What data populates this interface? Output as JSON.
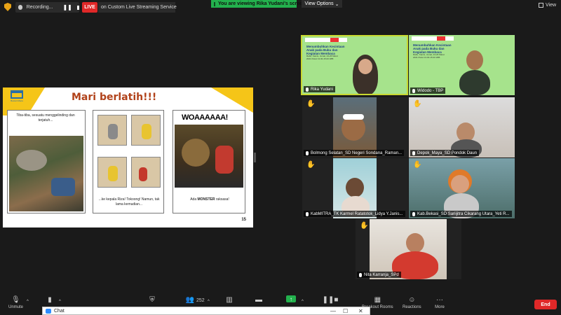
{
  "topbar": {
    "recording_label": "Recording...",
    "pause_icon": "pause-icon",
    "live_label": "LIVE",
    "live_service": "on Custom Live Streaming Service",
    "viewing_banner": "You are viewing Rika Yudani's screen",
    "view_options": "View Options",
    "view_label": "View"
  },
  "slide": {
    "title": "Mari berlatih!!!",
    "logo_text": "Bestari Maca",
    "panel1_text": "Tiba-tiba, sesuatu menggelinding dan terjatuh...",
    "panel2_text": "...ke kepala Riza! Tokoong! Namun, tak lama kemudian...",
    "panel3_heading": "WOAAAAAA!",
    "panel3_text_prefix": "Ada ",
    "panel3_text_bold": "MONSTER",
    "panel3_text_suffix": " raksasa!",
    "page_number": "15"
  },
  "participants": [
    {
      "name": "Rika Yudani",
      "banner_title": "Menumbuhkan Kecintaan Anak pada Buku dan Kegiatan Membaca",
      "banner_info": "Rabu, Kamis, Jumat, 24-26 Maret 2021 Pukul 13.00-15.00 WIB",
      "raised_hand": false,
      "active": true
    },
    {
      "name": "Widodo - TBP",
      "banner_title": "Menumbuhkan Kecintaan Anak pada Buku dan Kegiatan Membaca",
      "banner_info": "Rabu, Kamis, Jumat, 24-26 Maret 2021 Pukul 13.00-15.00 WIB",
      "raised_hand": false,
      "active": false
    },
    {
      "name": "Bolmong Selatan_SD Negeri Sondana_Raman...",
      "raised_hand": true,
      "active": false
    },
    {
      "name": "Depok_Maya_SD Pondok Daun",
      "raised_hand": true,
      "active": false
    },
    {
      "name": "KabMITRA_TK Karmel Ratatotok_Lidya Y.Janis...",
      "raised_hand": true,
      "active": false
    },
    {
      "name": "Kab.Bekasi_SD Sariijitra Cikarang Utara_Yeti R...",
      "raised_hand": true,
      "active": false
    },
    {
      "name": "Nita Karranja_SPd",
      "raised_hand": true,
      "active": false
    }
  ],
  "toolbar": {
    "unmute": "Unmute",
    "participants_count": "252",
    "breakout": "Breakout Rooms",
    "reactions": "Reactions",
    "more": "More",
    "end": "End"
  },
  "chat": {
    "title": "Chat"
  },
  "colors": {
    "live_red": "#e02828",
    "share_green": "#23b14d",
    "active_speaker": "#c8d830",
    "raise_hand": "#f5c518"
  }
}
